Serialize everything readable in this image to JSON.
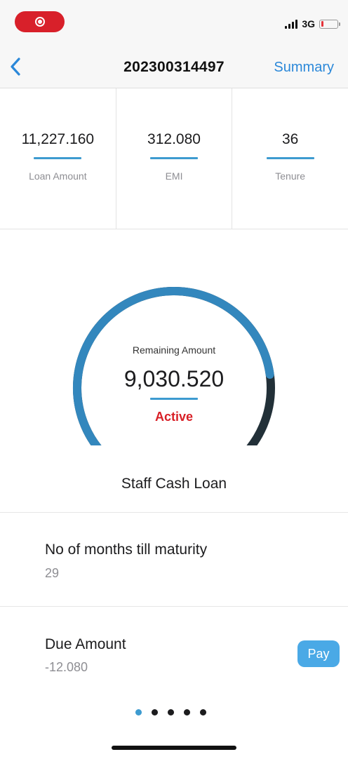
{
  "status_bar": {
    "network": "3G",
    "record_icon": "record-icon",
    "battery_level": 0.15,
    "colors": {
      "record": "#d8202a",
      "battery_low": "#e5343b"
    }
  },
  "nav": {
    "back_icon": "chevron-left-icon",
    "title": "202300314497",
    "action_label": "Summary"
  },
  "stats": [
    {
      "value": "11,227.160",
      "label": "Loan Amount"
    },
    {
      "value": "312.080",
      "label": "EMI"
    },
    {
      "value": "36",
      "label": "Tenure"
    }
  ],
  "gauge": {
    "caption": "Remaining Amount",
    "value": "9,030.520",
    "status": "Active",
    "fraction": 0.804,
    "colors": {
      "track": "#223038",
      "fill": "#3387bd",
      "status": "#d81f26"
    }
  },
  "loan_type": "Staff Cash Loan",
  "maturity": {
    "title": "No of months till maturity",
    "value": "29"
  },
  "due": {
    "title": "Due Amount",
    "value": "-12.080",
    "pay_label": "Pay"
  },
  "pager": {
    "count": 5,
    "active_index": 0
  },
  "colors": {
    "accent": "#2b88d9",
    "underline": "#3d9bd0",
    "pay_button": "#4aa9e6"
  }
}
